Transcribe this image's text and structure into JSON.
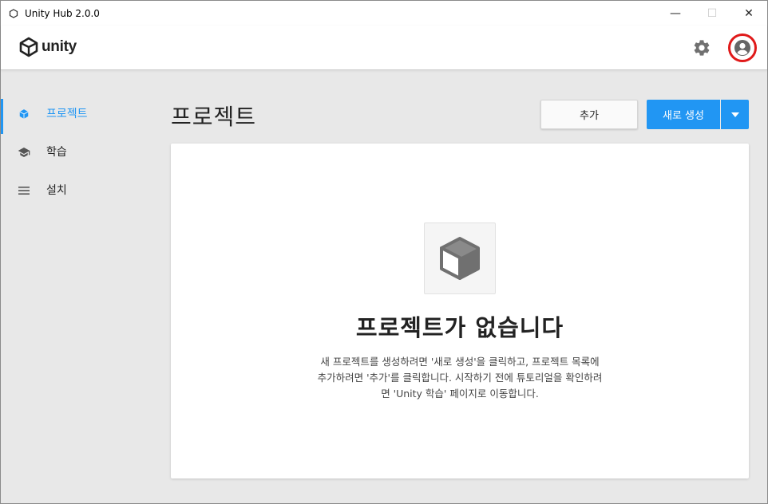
{
  "window": {
    "title": "Unity Hub 2.0.0",
    "minimize_glyph": "—",
    "maximize_glyph": "☐",
    "close_glyph": "✕"
  },
  "header": {
    "logo_text": "unity",
    "settings_icon": "gear-icon",
    "account_icon": "account-circle-icon"
  },
  "sidebar": {
    "items": [
      {
        "label": "프로젝트",
        "icon": "cube-icon",
        "active": true
      },
      {
        "label": "학습",
        "icon": "graduation-cap-icon",
        "active": false
      },
      {
        "label": "설치",
        "icon": "list-icon",
        "active": false
      }
    ]
  },
  "main": {
    "title": "프로젝트",
    "add_label": "추가",
    "new_label": "새로 생성",
    "empty": {
      "title": "프로젝트가 없습니다",
      "line1": "새 프로젝트를 생성하려면 '새로 생성'을 클릭하고, 프로젝트 목록에",
      "line2": "추가하려면 '추가'를 클릭합니다. 시작하기 전에 튜토리얼을 확인하려",
      "line3": "면 'Unity 학습' 페이지로 이동합니다."
    }
  },
  "colors": {
    "accent": "#2196f3",
    "highlight_circle": "#e01a1a",
    "icon_gray": "#707070"
  }
}
